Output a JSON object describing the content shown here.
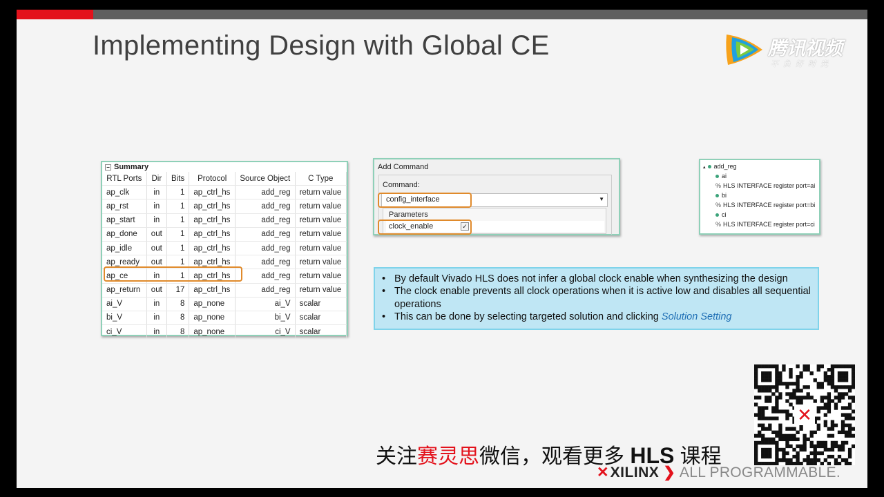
{
  "slide": {
    "title": "Implementing Design with Global CE"
  },
  "logo": {
    "brand": "腾讯视频",
    "slogan": "不负好时光",
    "icon": "tencent-video-play-icon"
  },
  "summary_table": {
    "header": "Summary",
    "columns": [
      "RTL Ports",
      "Dir",
      "Bits",
      "Protocol",
      "Source Object",
      "C Type"
    ],
    "rows": [
      [
        "ap_clk",
        "in",
        "1",
        "ap_ctrl_hs",
        "add_reg",
        "return value"
      ],
      [
        "ap_rst",
        "in",
        "1",
        "ap_ctrl_hs",
        "add_reg",
        "return value"
      ],
      [
        "ap_start",
        "in",
        "1",
        "ap_ctrl_hs",
        "add_reg",
        "return value"
      ],
      [
        "ap_done",
        "out",
        "1",
        "ap_ctrl_hs",
        "add_reg",
        "return value"
      ],
      [
        "ap_idle",
        "out",
        "1",
        "ap_ctrl_hs",
        "add_reg",
        "return value"
      ],
      [
        "ap_ready",
        "out",
        "1",
        "ap_ctrl_hs",
        "add_reg",
        "return value"
      ],
      [
        "ap_ce",
        "in",
        "1",
        "ap_ctrl_hs",
        "add_reg",
        "return value"
      ],
      [
        "ap_return",
        "out",
        "17",
        "ap_ctrl_hs",
        "add_reg",
        "return value"
      ],
      [
        "ai_V",
        "in",
        "8",
        "ap_none",
        "ai_V",
        "scalar"
      ],
      [
        "bi_V",
        "in",
        "8",
        "ap_none",
        "bi_V",
        "scalar"
      ],
      [
        "ci_V",
        "in",
        "8",
        "ap_none",
        "ci_V",
        "scalar"
      ]
    ]
  },
  "add_command": {
    "title": "Add Command",
    "command_label": "Command:",
    "command_value": "config_interface",
    "parameters_label": "Parameters",
    "parameter_name": "clock_enable",
    "parameter_checked": "✓"
  },
  "directives": {
    "root": "add_reg",
    "items": [
      {
        "name": "ai",
        "directive": "HLS INTERFACE register port=ai"
      },
      {
        "name": "bi",
        "directive": "HLS INTERFACE register port=bi"
      },
      {
        "name": "ci",
        "directive": "HLS INTERFACE register port=ci"
      }
    ],
    "pct": "%"
  },
  "notes": {
    "b1": "By default Vivado HLS does not infer a global clock enable when synthesizing the design",
    "b2": "The clock enable prevents all clock operations when it is active low and disables all sequential operations",
    "b3_text": "This can be done by selecting targeted solution and clicking ",
    "b3_link": "Solution Setting"
  },
  "footer": {
    "w1": "关注",
    "w2": "赛灵思",
    "w3": "微信，观看更多 ",
    "w4": "HLS",
    "w5": " 课程",
    "xilinx_name": "XILINX",
    "all_programmable": "ALL PROGRAMMABLE.",
    "qr": "wechat-qr-code-icon"
  },
  "colors": {
    "accent_red": "#e3121c",
    "highlight_orange": "#e08a2b",
    "panel_border": "#8fd0b8",
    "notes_bg": "#bfe6f4"
  }
}
